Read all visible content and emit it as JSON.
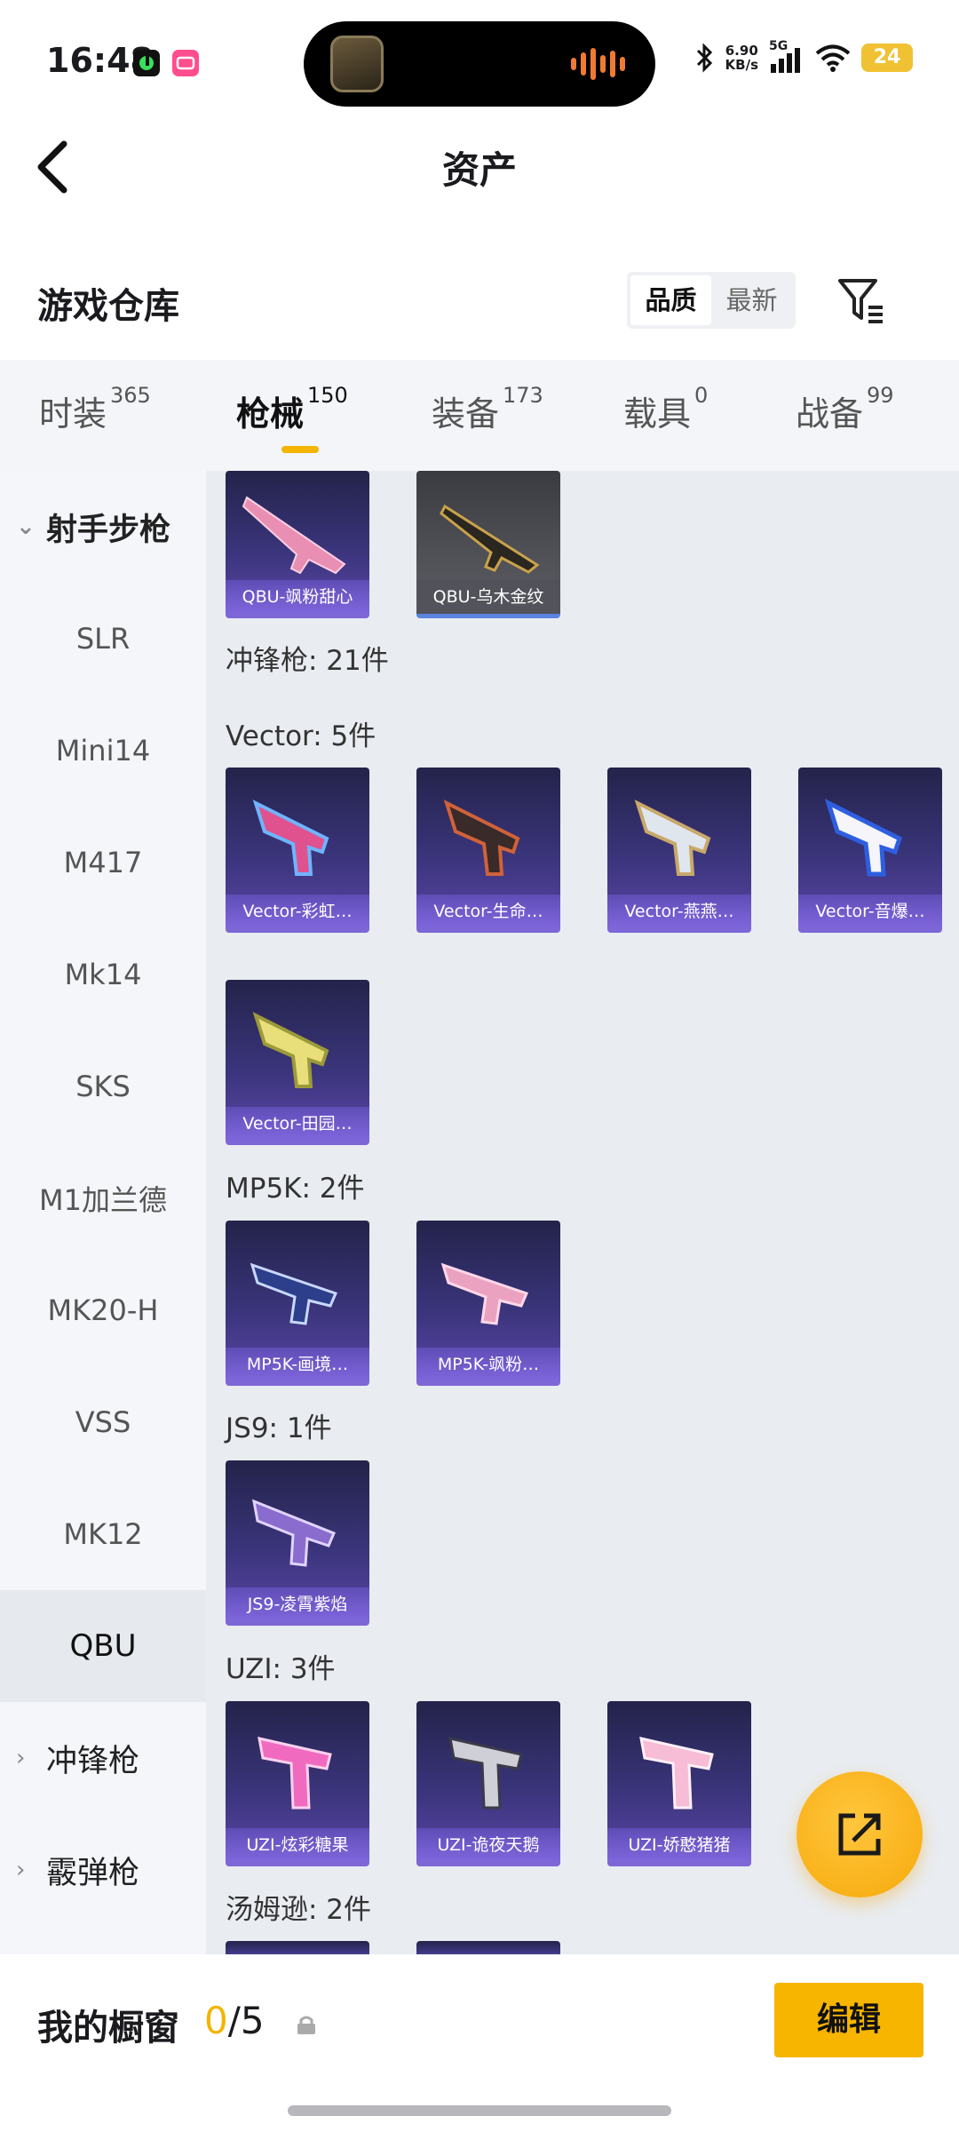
{
  "status_bar": {
    "time": "16:48",
    "net_speed_value": "6.90",
    "net_speed_unit": "KB/s",
    "network": "5G",
    "battery": "24"
  },
  "header": {
    "title": "资产"
  },
  "warehouse": {
    "title": "游戏仓库",
    "sort_options": [
      "品质",
      "最新"
    ],
    "active_sort": "品质"
  },
  "tabs": [
    {
      "label": "时装",
      "count": "365"
    },
    {
      "label": "枪械",
      "count": "150"
    },
    {
      "label": "装备",
      "count": "173"
    },
    {
      "label": "载具",
      "count": "0"
    },
    {
      "label": "战备",
      "count": "99"
    }
  ],
  "active_tab": "枪械",
  "sidebar": {
    "group_open": "射手步枪",
    "items": [
      "SLR",
      "Mini14",
      "M417",
      "Mk14",
      "SKS",
      "M1加兰德",
      "MK20-H",
      "VSS",
      "MK12",
      "QBU"
    ],
    "selected": "QBU",
    "groups_closed": [
      "冲锋枪",
      "霰弹枪"
    ]
  },
  "content": {
    "qbu_items": [
      "QBU-飒粉甜心",
      "QBU-乌木金纹"
    ],
    "smg_header": "冲锋枪: 21件",
    "vector_header": "Vector: 5件",
    "vector_items": [
      "Vector-彩虹…",
      "Vector-生命…",
      "Vector-燕燕…",
      "Vector-音爆…",
      "Vector-田园…"
    ],
    "mp5k_header": "MP5K: 2件",
    "mp5k_items": [
      "MP5K-画境…",
      "MP5K-飒粉…"
    ],
    "js9_header": "JS9: 1件",
    "js9_items": [
      "JS9-凌霄紫焰"
    ],
    "uzi_header": "UZI: 3件",
    "uzi_items": [
      "UZI-炫彩糖果",
      "UZI-诡夜天鹅",
      "UZI-娇憨猪猪"
    ],
    "tommy_header": "汤姆逊: 2件"
  },
  "bottom_bar": {
    "label": "我的橱窗",
    "current": "0",
    "total": "/5",
    "edit_label": "编辑"
  },
  "colors": {
    "accent": "#f7b500",
    "card_purple": "#3a347a",
    "sidebar_bg": "#f4f6f9"
  }
}
